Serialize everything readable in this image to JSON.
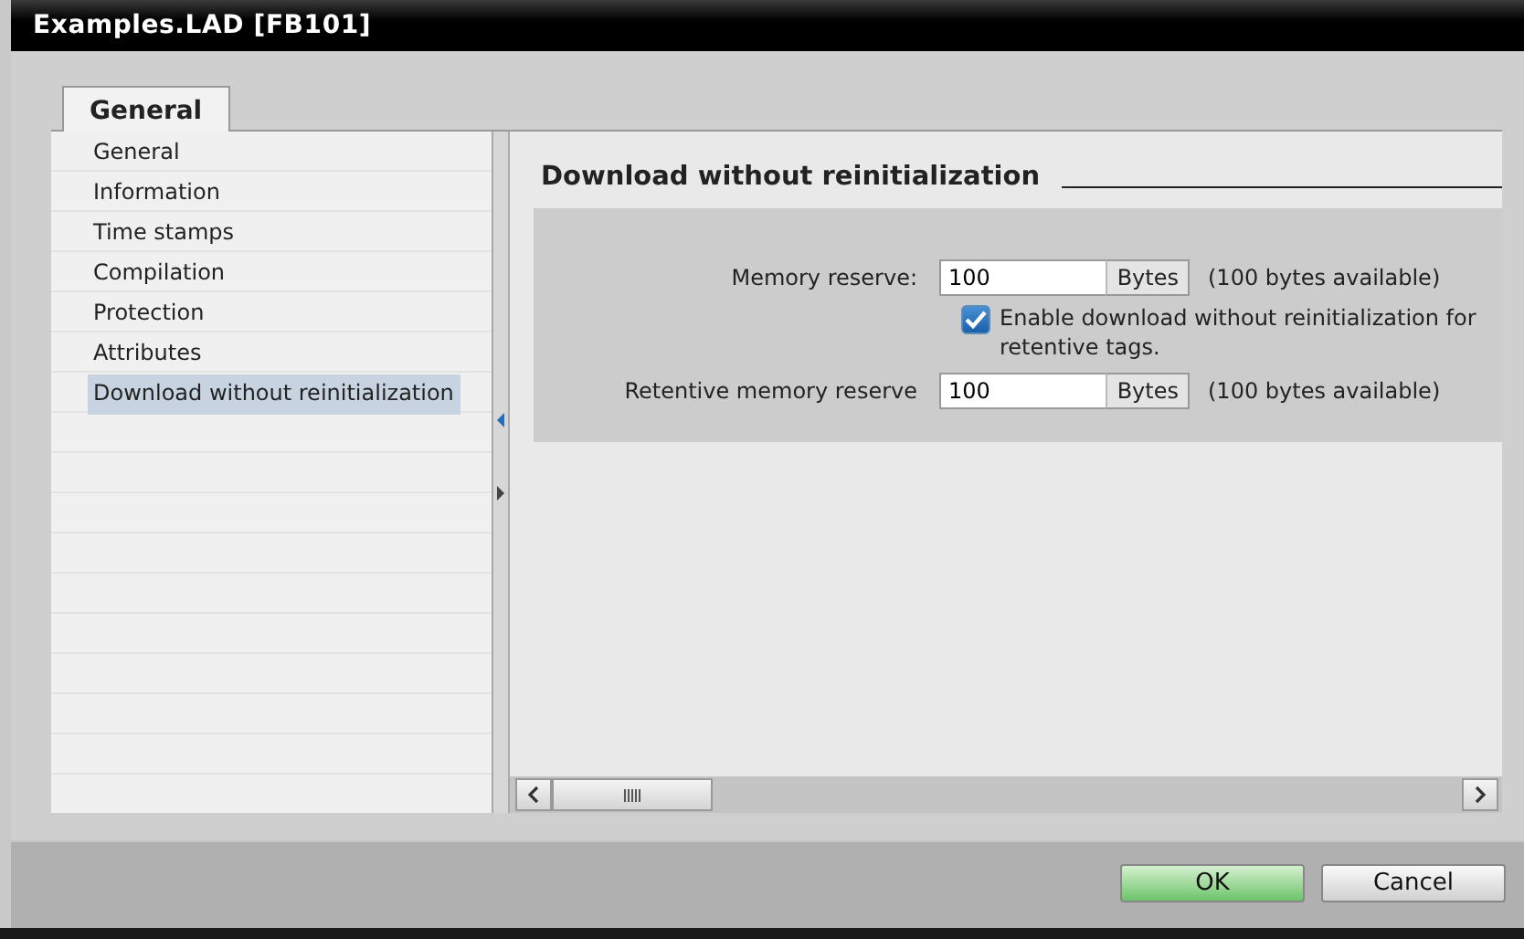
{
  "window": {
    "title": "Examples.LAD [FB101]"
  },
  "tabs": [
    {
      "label": "General",
      "selected": true
    }
  ],
  "sidebar": {
    "items": [
      {
        "label": "General",
        "selected": false
      },
      {
        "label": "Information",
        "selected": false
      },
      {
        "label": "Time stamps",
        "selected": false
      },
      {
        "label": "Compilation",
        "selected": false
      },
      {
        "label": "Protection",
        "selected": false
      },
      {
        "label": "Attributes",
        "selected": false
      },
      {
        "label": "Download without reinitialization",
        "selected": true
      }
    ]
  },
  "section": {
    "heading": "Download without reinitialization",
    "rows": [
      {
        "kind": "field",
        "label": "Memory reserve:",
        "value": "100",
        "unit": "Bytes",
        "note": "(100 bytes available)"
      },
      {
        "kind": "checkbox",
        "label": "Enable download without reinitialization for retentive tags.",
        "checked": true
      },
      {
        "kind": "field",
        "label": "Retentive memory reserve",
        "value": "100",
        "unit": "Bytes",
        "note": "(100 bytes available)"
      }
    ]
  },
  "buttons": [
    {
      "label": "OK",
      "kind": "primary"
    },
    {
      "label": "Cancel",
      "kind": "secondary"
    }
  ]
}
